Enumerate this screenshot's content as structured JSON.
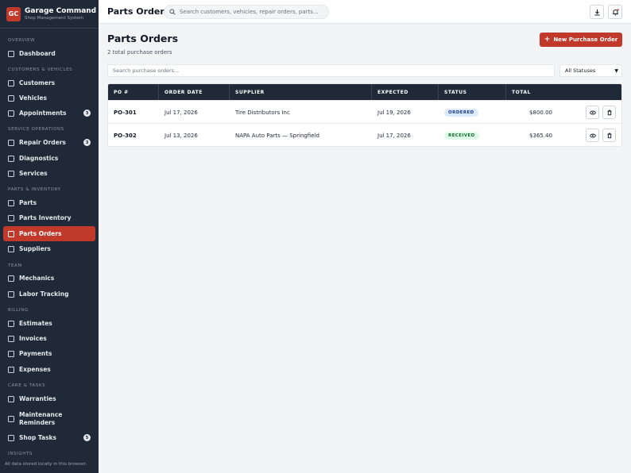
{
  "brand": {
    "logo": "GC",
    "title": "Garage Command",
    "subtitle": "Shop Management System"
  },
  "sidebar": {
    "sections": [
      {
        "label": "OVERVIEW"
      },
      {
        "label": "CUSTOMERS & VEHICLES"
      },
      {
        "label": "SERVICE OPERATIONS"
      },
      {
        "label": "PARTS & INVENTORY"
      },
      {
        "label": "TEAM"
      },
      {
        "label": "BILLING"
      },
      {
        "label": "CARE & TASKS"
      },
      {
        "label": "INSIGHTS"
      }
    ],
    "items": [
      {
        "label": "Dashboard",
        "icon": "grid-icon"
      },
      {
        "label": "Customers",
        "icon": "users-icon"
      },
      {
        "label": "Vehicles",
        "icon": "car-icon"
      },
      {
        "label": "Appointments",
        "icon": "calendar-icon",
        "badge": "3"
      },
      {
        "label": "Repair Orders",
        "icon": "clipboard-icon",
        "badge": "3"
      },
      {
        "label": "Diagnostics",
        "icon": "pulse-icon"
      },
      {
        "label": "Services",
        "icon": "wrench-icon"
      },
      {
        "label": "Parts",
        "icon": "gear-icon"
      },
      {
        "label": "Parts Inventory",
        "icon": "boxes-icon"
      },
      {
        "label": "Parts Orders",
        "icon": "truck-icon",
        "active": true
      },
      {
        "label": "Suppliers",
        "icon": "building-icon"
      },
      {
        "label": "Mechanics",
        "icon": "hardhat-icon"
      },
      {
        "label": "Labor Tracking",
        "icon": "clock-icon"
      },
      {
        "label": "Estimates",
        "icon": "document-icon"
      },
      {
        "label": "Invoices",
        "icon": "invoice-icon"
      },
      {
        "label": "Payments",
        "icon": "card-icon"
      },
      {
        "label": "Expenses",
        "icon": "dollar-icon"
      },
      {
        "label": "Warranties",
        "icon": "shield-icon"
      },
      {
        "label": "Maintenance Reminders",
        "icon": "bell-icon"
      },
      {
        "label": "Shop Tasks",
        "icon": "checkbox-icon",
        "badge": "5"
      }
    ],
    "footer": "All data stored locally in this browser."
  },
  "topbar": {
    "title": "Parts Orders",
    "search_placeholder": "Search customers, vehicles, repair orders, parts..."
  },
  "main": {
    "title": "Parts Orders",
    "subtitle": "2 total purchase orders",
    "new_button": "New Purchase Order",
    "filter_placeholder": "Search purchase orders...",
    "status_filter": "All Statuses",
    "columns": [
      "PO #",
      "ORDER DATE",
      "SUPPLIER",
      "EXPECTED",
      "STATUS",
      "TOTAL"
    ],
    "rows": [
      {
        "po": "PO-301",
        "order_date": "Jul 17, 2026",
        "supplier": "Tire Distributors Inc",
        "expected": "Jul 19, 2026",
        "status": "ORDERED",
        "total": "$800.00"
      },
      {
        "po": "PO-302",
        "order_date": "Jul 13, 2026",
        "supplier": "NAPA Auto Parts — Springfield",
        "expected": "Jul 17, 2026",
        "status": "RECEIVED",
        "total": "$365.40"
      }
    ]
  },
  "colors": {
    "accent": "#c0392b",
    "sidebar": "#1f2937",
    "ordered_badge": "#dbeafe",
    "received_badge": "#dcfce7"
  }
}
